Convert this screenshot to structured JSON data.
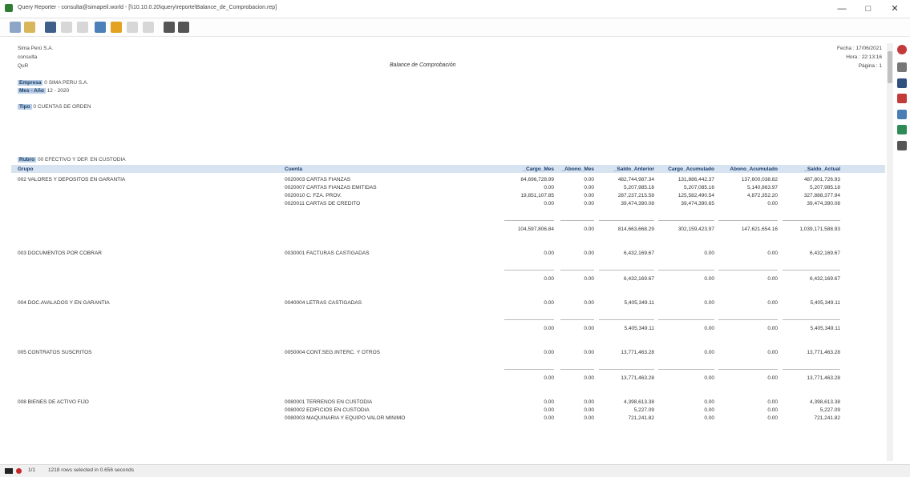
{
  "window": {
    "title": "Query Reporter - consulta@simapeil.world - [\\\\10.10.0.20\\query\\reporte\\Balance_de_Comprobacion.rep]",
    "min": "—",
    "max": "□",
    "close": "✕"
  },
  "report": {
    "company": "Sima Perú S.A.",
    "user": "consulta",
    "env": "QuR",
    "title": "Balance de Comprobación",
    "fecha": "Fecha : 17/06/2021",
    "hora": "Hora : 22:13:16",
    "pagina": "Página : 1",
    "empresa_label": "Empresa",
    "empresa_value": "0 SIMA PERU S.A.",
    "mes_label": "Mes - Año",
    "mes_value": "12 - 2020",
    "tipo_label": "Tipo",
    "tipo_value": "0 CUENTAS DE ORDEN",
    "rubro_label": "Rubro",
    "rubro_value": "00 EFECTIVO Y DEP. EN CUSTODIA"
  },
  "columns": {
    "grupo": "Grupo",
    "cuenta": "Cuenta",
    "cargo_mes": "_Cargo_Mes",
    "abono_mes": "_Abono_Mes",
    "saldo_anterior": "_Saldo_Anterior",
    "cargo_acumulado": "Cargo_Acumulado",
    "abono_acumulado": "Abono_Acumulado",
    "saldo_actual": "_Saldo_Actual"
  },
  "groups": [
    {
      "grupo": "002 VALORES Y DEPOSITOS EN GARANTIA",
      "rows": [
        {
          "cuenta": "0020003 CARTAS FIANZAS",
          "cargo": "84,696,728.99",
          "abono": "0.00",
          "sant": "482,744,987.34",
          "cacu": "131,886,442.37",
          "aacu": "137,600,038.82",
          "sact": "487,801,726.93"
        },
        {
          "cuenta": "0020007 CARTAS FIANZAS EMITIDAS",
          "cargo": "0.00",
          "abono": "0.00",
          "sant": "5,207,985.18",
          "cacu": "5,207,085.16",
          "aacu": "5,140,863.97",
          "sact": "5,207,985.18"
        },
        {
          "cuenta": "0020010 C. FZA. PROV.",
          "cargo": "19,851,107.85",
          "abono": "0.00",
          "sant": "287,237,215.58",
          "cacu": "125,582,490.54",
          "aacu": "4,872,352.20",
          "sact": "327,888,377.94"
        },
        {
          "cuenta": "0020011 CARTAS DE CREDITO",
          "cargo": "0.00",
          "abono": "0.00",
          "sant": "39,474,390.08",
          "cacu": "39,474,390.65",
          "aacu": "0.00",
          "sact": "39,474,390.08"
        }
      ],
      "total": {
        "cargo": "104,597,806.84",
        "abono": "0.00",
        "sant": "814,663,668.29",
        "cacu": "302,159,423.97",
        "aacu": "147,621,654.16",
        "sact": "1,039,171,588.93"
      }
    },
    {
      "grupo": "003 DOCUMENTOS POR COBRAR",
      "rows": [
        {
          "cuenta": "0030001 FACTURAS CASTIGADAS",
          "cargo": "0.00",
          "abono": "0.00",
          "sant": "6,432,169.67",
          "cacu": "0.00",
          "aacu": "0.00",
          "sact": "6,432,169.67"
        }
      ],
      "total": {
        "cargo": "0.00",
        "abono": "0.00",
        "sant": "6,432,169.67",
        "cacu": "0.00",
        "aacu": "0.00",
        "sact": "6,432,169.67"
      }
    },
    {
      "grupo": "004 DOC.AVALADOS Y EN GARANTIA",
      "rows": [
        {
          "cuenta": "0040004 LETRAS CASTIGADAS",
          "cargo": "0.00",
          "abono": "0.00",
          "sant": "5,405,349.11",
          "cacu": "0.00",
          "aacu": "0.00",
          "sact": "5,405,349.11"
        }
      ],
      "total": {
        "cargo": "0.00",
        "abono": "0.00",
        "sant": "5,405,349.11",
        "cacu": "0.00",
        "aacu": "0.00",
        "sact": "5,405,349.11"
      }
    },
    {
      "grupo": "005 CONTRATOS SUSCRITOS",
      "rows": [
        {
          "cuenta": "0050004 CONT.SEG.INTERC. Y OTROS",
          "cargo": "0.00",
          "abono": "0.00",
          "sant": "13,771,463.28",
          "cacu": "0.00",
          "aacu": "0.00",
          "sact": "13,771,463.28"
        }
      ],
      "total": {
        "cargo": "0.00",
        "abono": "0.00",
        "sant": "13,771,463.28",
        "cacu": "0.00",
        "aacu": "0.00",
        "sact": "13,771,463.28"
      }
    },
    {
      "grupo": "008 BIENES DE ACTIVO FIJO",
      "rows": [
        {
          "cuenta": "0080001 TERRENOS EN CUSTODIA",
          "cargo": "0.00",
          "abono": "0.00",
          "sant": "4,398,613.38",
          "cacu": "0.00",
          "aacu": "0.00",
          "sact": "4,398,613.38"
        },
        {
          "cuenta": "0080002 EDIFICIOS EN CUSTODIA",
          "cargo": "0.00",
          "abono": "0.00",
          "sant": "5,227.09",
          "cacu": "0.00",
          "aacu": "0.00",
          "sact": "5,227.09"
        },
        {
          "cuenta": "0080003 MAQUINARIA Y EQUIPO VALOR MINIMO",
          "cargo": "0.00",
          "abono": "0.00",
          "sant": "721,241.82",
          "cacu": "0.00",
          "aacu": "0.00",
          "sact": "721,241.82"
        }
      ]
    }
  ],
  "status": {
    "page": "1/1",
    "message": "1218 rows selected in 0.656 seconds"
  }
}
